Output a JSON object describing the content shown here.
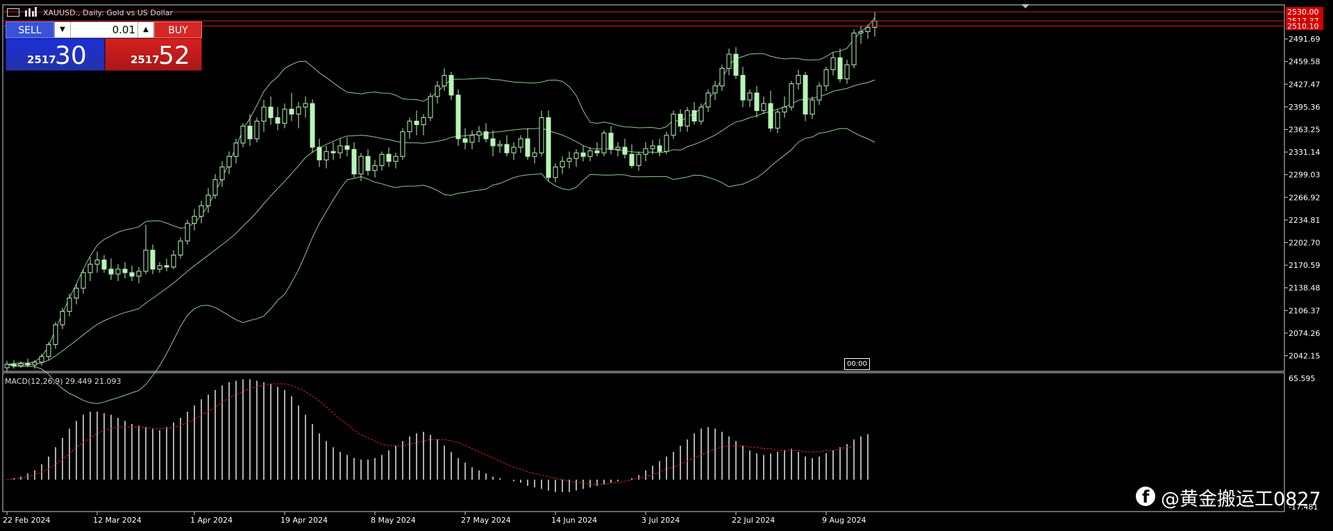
{
  "window": {
    "title": "XAUUSD., Daily:  Gold vs US Dollar"
  },
  "trade_panel": {
    "sell_label": "SELL",
    "buy_label": "BUY",
    "lot_value": "0.01",
    "sell_price_prefix": "2517",
    "sell_price_big": "30",
    "buy_price_prefix": "2517",
    "buy_price_big": "52",
    "sell_color": "#2332a8",
    "buy_color": "#c81e1e"
  },
  "price_tags": {
    "top": "2530.00",
    "bid": "2517.37",
    "low": "2510.10"
  },
  "time_tag": "00:00",
  "indicator": {
    "label": "MACD(12,26,9) 29.449 21.093"
  },
  "watermark": {
    "text": "@黄金搬运工0827",
    "icon": "facebook-icon"
  },
  "colors": {
    "bull": "#b8f5b8",
    "bear": "#b8f5b8",
    "band": "#8fc98f",
    "signal": "#e02020",
    "hline": "#e02020",
    "grid_text": "#ffffff"
  },
  "chart_data": [
    {
      "type": "candlestick",
      "title": "XAUUSD., Daily:  Gold vs US Dollar",
      "ylim": [
        2020,
        2540
      ],
      "y_ticks": [
        "2491.69",
        "2459.58",
        "2427.47",
        "2395.36",
        "2363.25",
        "2331.14",
        "2299.03",
        "2266.92",
        "2234.81",
        "2202.70",
        "2170.59",
        "2138.48",
        "2106.37",
        "2074.26",
        "2042.15"
      ],
      "x_ticks": [
        "22 Feb 2024",
        "12 Mar 2024",
        "1 Apr 2024",
        "19 Apr 2024",
        "8 May 2024",
        "27 May 2024",
        "14 Jun 2024",
        "3 Jul 2024",
        "22 Jul 2024",
        "9 Aug 2024"
      ],
      "x_tick_index": [
        0,
        13,
        27,
        40,
        53,
        66,
        79,
        92,
        105,
        118
      ],
      "hlines": [
        2530.0,
        2517.37,
        2510.1
      ],
      "ohlc": [
        [
          2025,
          2035,
          2020,
          2030
        ],
        [
          2030,
          2036,
          2024,
          2028
        ],
        [
          2028,
          2034,
          2025,
          2031
        ],
        [
          2031,
          2038,
          2026,
          2029
        ],
        [
          2029,
          2036,
          2024,
          2033
        ],
        [
          2033,
          2045,
          2028,
          2041
        ],
        [
          2041,
          2062,
          2036,
          2058
        ],
        [
          2058,
          2090,
          2052,
          2086
        ],
        [
          2086,
          2110,
          2080,
          2105
        ],
        [
          2105,
          2130,
          2098,
          2124
        ],
        [
          2124,
          2145,
          2115,
          2138
        ],
        [
          2138,
          2165,
          2130,
          2160
        ],
        [
          2160,
          2182,
          2148,
          2172
        ],
        [
          2172,
          2190,
          2160,
          2178
        ],
        [
          2178,
          2185,
          2160,
          2165
        ],
        [
          2165,
          2180,
          2150,
          2158
        ],
        [
          2158,
          2172,
          2148,
          2165
        ],
        [
          2165,
          2175,
          2152,
          2160
        ],
        [
          2160,
          2170,
          2148,
          2155
        ],
        [
          2155,
          2168,
          2145,
          2162
        ],
        [
          2162,
          2228,
          2158,
          2192
        ],
        [
          2192,
          2200,
          2158,
          2165
        ],
        [
          2165,
          2175,
          2160,
          2170
        ],
        [
          2170,
          2180,
          2162,
          2168
        ],
        [
          2168,
          2192,
          2165,
          2185
        ],
        [
          2185,
          2210,
          2180,
          2205
        ],
        [
          2205,
          2235,
          2200,
          2230
        ],
        [
          2230,
          2250,
          2220,
          2240
        ],
        [
          2240,
          2262,
          2230,
          2255
        ],
        [
          2255,
          2280,
          2245,
          2270
        ],
        [
          2270,
          2300,
          2265,
          2292
        ],
        [
          2292,
          2318,
          2282,
          2310
        ],
        [
          2310,
          2332,
          2300,
          2325
        ],
        [
          2325,
          2350,
          2315,
          2344
        ],
        [
          2344,
          2372,
          2338,
          2368
        ],
        [
          2368,
          2385,
          2340,
          2350
        ],
        [
          2350,
          2380,
          2345,
          2375
        ],
        [
          2375,
          2405,
          2360,
          2395
        ],
        [
          2395,
          2410,
          2370,
          2380
        ],
        [
          2380,
          2395,
          2362,
          2372
        ],
        [
          2372,
          2400,
          2365,
          2392
        ],
        [
          2392,
          2415,
          2375,
          2385
        ],
        [
          2385,
          2402,
          2365,
          2395
        ],
        [
          2395,
          2410,
          2380,
          2400
        ],
        [
          2400,
          2406,
          2330,
          2338
        ],
        [
          2338,
          2350,
          2310,
          2320
        ],
        [
          2320,
          2340,
          2308,
          2332
        ],
        [
          2332,
          2345,
          2320,
          2330
        ],
        [
          2330,
          2350,
          2322,
          2340
        ],
        [
          2340,
          2352,
          2325,
          2335
        ],
        [
          2335,
          2345,
          2295,
          2300
        ],
        [
          2300,
          2330,
          2290,
          2325
        ],
        [
          2325,
          2335,
          2298,
          2305
        ],
        [
          2305,
          2320,
          2295,
          2312
        ],
        [
          2312,
          2332,
          2305,
          2328
        ],
        [
          2328,
          2338,
          2310,
          2318
        ],
        [
          2318,
          2330,
          2308,
          2325
        ],
        [
          2325,
          2365,
          2320,
          2360
        ],
        [
          2360,
          2380,
          2350,
          2375
        ],
        [
          2375,
          2390,
          2355,
          2370
        ],
        [
          2370,
          2385,
          2355,
          2380
        ],
        [
          2380,
          2415,
          2375,
          2410
        ],
        [
          2410,
          2432,
          2400,
          2425
        ],
        [
          2425,
          2450,
          2418,
          2440
        ],
        [
          2440,
          2445,
          2405,
          2412
        ],
        [
          2412,
          2420,
          2340,
          2350
        ],
        [
          2350,
          2365,
          2335,
          2345
        ],
        [
          2345,
          2362,
          2335,
          2355
        ],
        [
          2355,
          2368,
          2345,
          2360
        ],
        [
          2360,
          2372,
          2345,
          2350
        ],
        [
          2350,
          2362,
          2325,
          2340
        ],
        [
          2340,
          2348,
          2330,
          2342
        ],
        [
          2342,
          2355,
          2325,
          2330
        ],
        [
          2330,
          2345,
          2320,
          2338
        ],
        [
          2338,
          2355,
          2330,
          2350
        ],
        [
          2350,
          2365,
          2320,
          2325
        ],
        [
          2325,
          2338,
          2315,
          2330
        ],
        [
          2330,
          2390,
          2325,
          2380
        ],
        [
          2380,
          2390,
          2290,
          2295
        ],
        [
          2295,
          2315,
          2288,
          2310
        ],
        [
          2310,
          2325,
          2300,
          2318
        ],
        [
          2318,
          2332,
          2308,
          2322
        ],
        [
          2322,
          2335,
          2310,
          2330
        ],
        [
          2330,
          2340,
          2318,
          2325
        ],
        [
          2325,
          2338,
          2318,
          2333
        ],
        [
          2333,
          2345,
          2325,
          2330
        ],
        [
          2330,
          2362,
          2325,
          2358
        ],
        [
          2358,
          2368,
          2328,
          2335
        ],
        [
          2335,
          2345,
          2325,
          2338
        ],
        [
          2338,
          2350,
          2322,
          2328
        ],
        [
          2328,
          2342,
          2308,
          2312
        ],
        [
          2312,
          2332,
          2305,
          2328
        ],
        [
          2328,
          2345,
          2318,
          2336
        ],
        [
          2336,
          2348,
          2328,
          2340
        ],
        [
          2340,
          2350,
          2325,
          2332
        ],
        [
          2332,
          2360,
          2328,
          2355
        ],
        [
          2355,
          2390,
          2350,
          2385
        ],
        [
          2385,
          2392,
          2360,
          2368
        ],
        [
          2368,
          2395,
          2360,
          2390
        ],
        [
          2390,
          2402,
          2370,
          2375
        ],
        [
          2375,
          2400,
          2370,
          2395
        ],
        [
          2395,
          2420,
          2388,
          2415
        ],
        [
          2415,
          2432,
          2405,
          2425
        ],
        [
          2425,
          2455,
          2418,
          2450
        ],
        [
          2450,
          2478,
          2440,
          2470
        ],
        [
          2470,
          2480,
          2435,
          2440
        ],
        [
          2440,
          2452,
          2395,
          2405
        ],
        [
          2405,
          2420,
          2395,
          2415
        ],
        [
          2415,
          2425,
          2380,
          2390
        ],
        [
          2390,
          2410,
          2385,
          2400
        ],
        [
          2400,
          2418,
          2360,
          2365
        ],
        [
          2365,
          2392,
          2358,
          2388
        ],
        [
          2388,
          2410,
          2380,
          2395
        ],
        [
          2395,
          2432,
          2390,
          2428
        ],
        [
          2428,
          2448,
          2420,
          2440
        ],
        [
          2440,
          2445,
          2375,
          2385
        ],
        [
          2385,
          2410,
          2378,
          2405
        ],
        [
          2405,
          2430,
          2398,
          2425
        ],
        [
          2425,
          2452,
          2418,
          2448
        ],
        [
          2448,
          2472,
          2440,
          2465
        ],
        [
          2465,
          2478,
          2430,
          2435
        ],
        [
          2435,
          2462,
          2428,
          2455
        ],
        [
          2455,
          2505,
          2450,
          2500
        ],
        [
          2500,
          2510,
          2485,
          2502
        ],
        [
          2502,
          2512,
          2492,
          2508
        ],
        [
          2508,
          2530,
          2495,
          2517
        ]
      ]
    },
    {
      "type": "bar",
      "title": "MACD(12,26,9) 29.449 21.093",
      "ylim": [
        -17.481,
        65.595
      ],
      "y_ticks": [
        "65.595",
        "-17.481"
      ],
      "macd": [
        0,
        1,
        2,
        4,
        6,
        10,
        15,
        21,
        27,
        33,
        38,
        42,
        44,
        44,
        43,
        42,
        40,
        38,
        36,
        35,
        34,
        33,
        32,
        34,
        37,
        40,
        44,
        48,
        52,
        55,
        58,
        61,
        63,
        64,
        65,
        65,
        64,
        63,
        62,
        60,
        58,
        54,
        48,
        42,
        36,
        30,
        25,
        21,
        18,
        16,
        14,
        13,
        13,
        14,
        16,
        19,
        22,
        25,
        28,
        30,
        31,
        29,
        26,
        22,
        18,
        14,
        11,
        8,
        6,
        4,
        2,
        1,
        0,
        -1,
        -2,
        -4,
        -5,
        -6,
        -7,
        -8,
        -8,
        -8,
        -7,
        -6,
        -5,
        -4,
        -3,
        -2,
        -1,
        0,
        1,
        3,
        6,
        9,
        12,
        15,
        18,
        22,
        26,
        30,
        33,
        34,
        33,
        31,
        28,
        25,
        22,
        19,
        17,
        16,
        17,
        18,
        19,
        20,
        18,
        15,
        14,
        15,
        17,
        19,
        21,
        23,
        26,
        28,
        29.449
      ],
      "signal": [
        0,
        0.5,
        1,
        2,
        3,
        5,
        7,
        10,
        13,
        17,
        21,
        24,
        27,
        30,
        32,
        33,
        34,
        34,
        34,
        34,
        34,
        33,
        33,
        33,
        34,
        35,
        37,
        39,
        42,
        44,
        47,
        50,
        53,
        55,
        57,
        59,
        60,
        61,
        62,
        62,
        62,
        61,
        59,
        57,
        54,
        51,
        47,
        43,
        39,
        36,
        32,
        29,
        27,
        25,
        23,
        22,
        22,
        22,
        23,
        24,
        25,
        26,
        26,
        26,
        25,
        24,
        22,
        20,
        18,
        16,
        14,
        12,
        10,
        8,
        7,
        5,
        4,
        3,
        2,
        1,
        0,
        -1,
        -2,
        -2,
        -3,
        -3,
        -3,
        -2,
        -2,
        -1,
        0,
        1,
        2,
        3,
        5,
        7,
        8,
        10,
        12,
        14,
        16,
        18,
        20,
        21,
        22,
        22,
        22,
        21,
        21,
        20,
        20,
        19,
        19,
        19,
        19,
        18,
        18,
        18,
        19,
        19,
        20,
        21,
        21.093
      ]
    }
  ]
}
